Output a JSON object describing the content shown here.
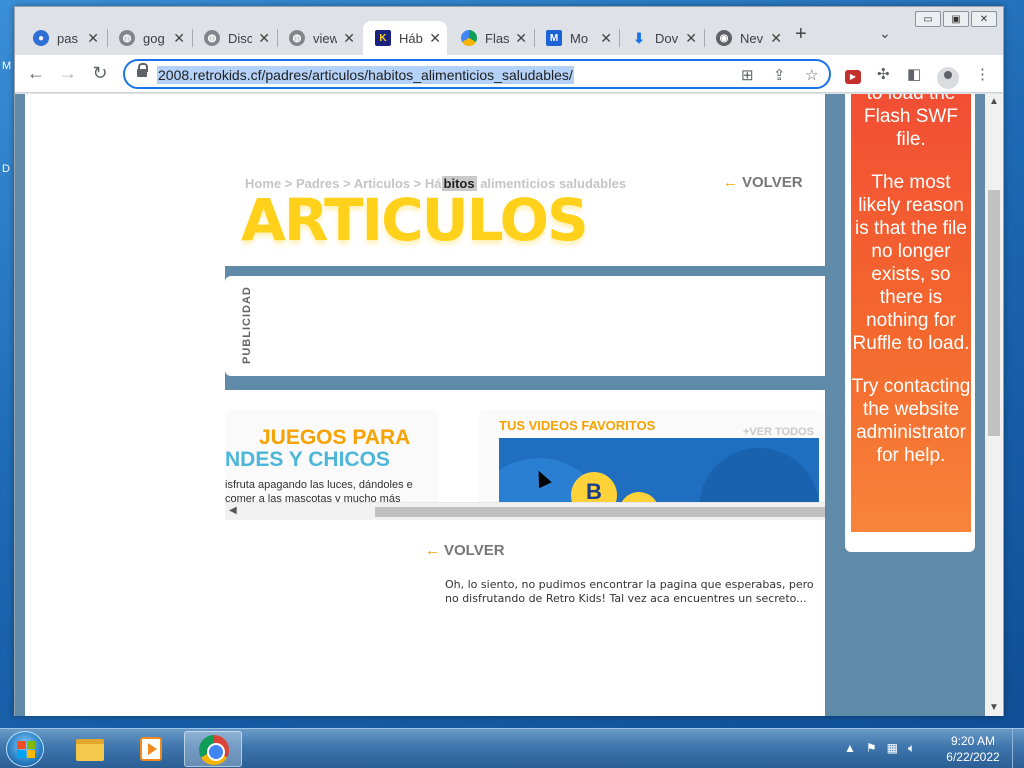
{
  "desktop": {
    "edge_letter_1": "M",
    "edge_letter_2": "D"
  },
  "window": {
    "caption": {
      "minimize": "▭",
      "maximize": "▣",
      "close": "✕"
    }
  },
  "tabs": [
    {
      "title": "pas",
      "icon": "swirl-icon",
      "color": "#2f6fd6"
    },
    {
      "title": "gog",
      "icon": "globe-icon",
      "color": "#5f6368"
    },
    {
      "title": "Disc",
      "icon": "globe-icon",
      "color": "#5f6368"
    },
    {
      "title": "view",
      "icon": "globe-icon",
      "color": "#5f6368"
    },
    {
      "title": "Háb",
      "icon": "retrokids-icon",
      "color": "#1a237e",
      "active": true
    },
    {
      "title": "Flas",
      "icon": "drive-icon",
      "color": "#e8a400"
    },
    {
      "title": "Mo",
      "icon": "m-icon",
      "color": "#1e63d6"
    },
    {
      "title": "Dov",
      "icon": "download-icon",
      "color": "#1a73e8"
    },
    {
      "title": "Nev",
      "icon": "chrome-icon",
      "color": "#5f6368"
    }
  ],
  "address_bar": {
    "url": "2008.retrokids.cf/padres/articulos/habitos_alimenticios_saludables/"
  },
  "page": {
    "breadcrumb": {
      "home": "Home",
      "sep": ">",
      "padres": "Padres",
      "articulos": "Articulos",
      "current_pre": "Há",
      "current_hl": "bitos",
      "current_post": " alimenticios saludables"
    },
    "volver": "VOLVER",
    "title": "ARTICULOS",
    "publicidad": "PUBLICIDAD",
    "juegos_line1": "JUEGOS PARA",
    "juegos_line2": "NDES Y CHICOS",
    "juegos_text": "isfruta apagando las luces, dándoles e comer a las mascotas y mucho más",
    "videos_title": "TUS VIDEOS FAVORITOS",
    "ver_todos": "+VER TODOS",
    "video_letter": "B",
    "not_found_message": "Oh, lo siento, no pudimos encontrar la pagina que esperabas, pero no disfrutando de Retro Kids! Tal vez aca encuentres un secreto..."
  },
  "ruffle": {
    "p1": "to load the Flash SWF file.",
    "p2": "The most likely reason is that the file no longer exists, so there is nothing for Ruffle to load.",
    "p3": "Try contacting the website administrator for help."
  },
  "taskbar": {
    "time": "9:20 AM",
    "date": "6/22/2022"
  }
}
